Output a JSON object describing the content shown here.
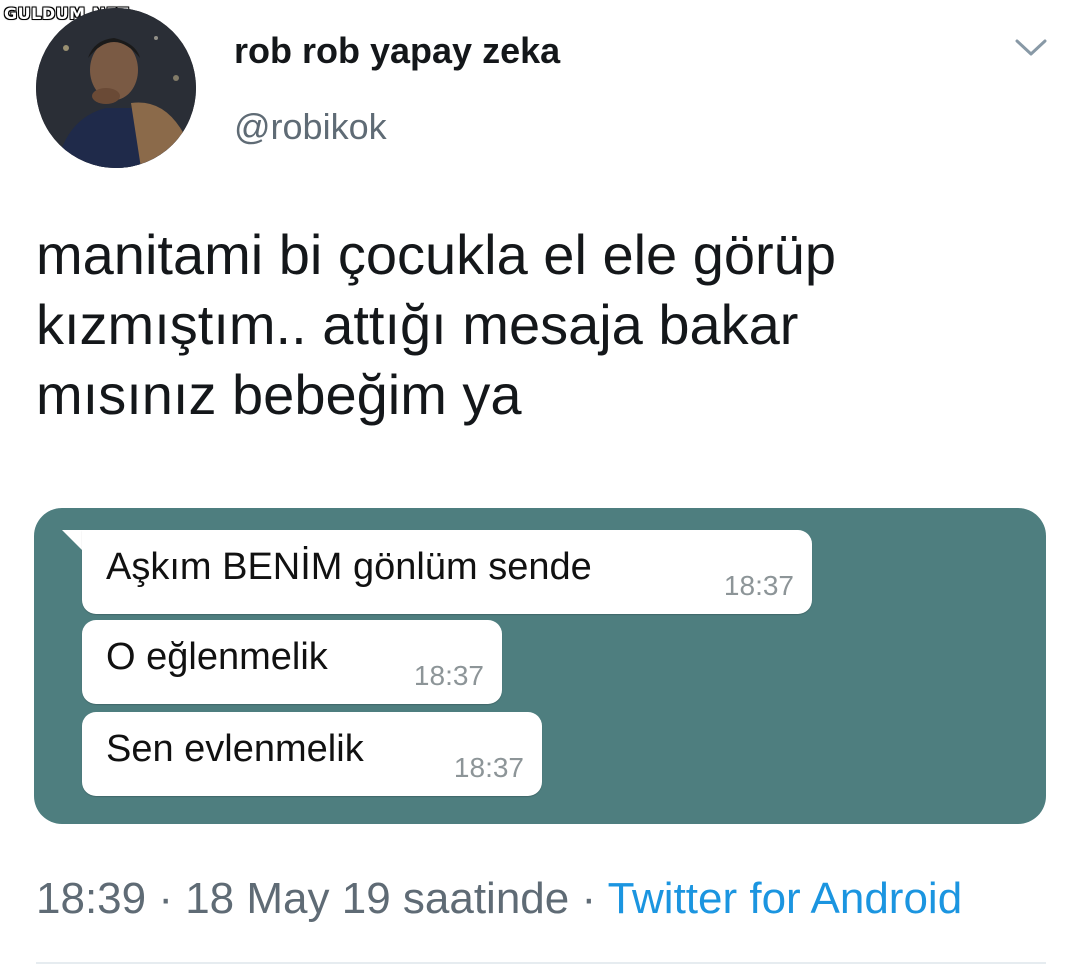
{
  "watermark": "GULDUM.NET",
  "author": {
    "display_name": "rob rob yapay zeka",
    "handle": "@robikok",
    "avatar": "avatar-photo"
  },
  "menu_icon": "chevron-down-icon",
  "tweet": {
    "text": "manitami bi çocukla el ele görüp\nkızmıştım.. attığı mesaja bakar\nmısınız bebeğim ya"
  },
  "chat": {
    "background": "#4e7e7f",
    "messages": [
      {
        "text": "Aşkım BENİM gönlüm sende",
        "time": "18:37"
      },
      {
        "text": "O eğlenmelik",
        "time": "18:37"
      },
      {
        "text": "Sen evlenmelik",
        "time": "18:37"
      }
    ]
  },
  "meta": {
    "timestamp": "18:39 · 18 May 19 saatinde · ",
    "source": "Twitter for Android",
    "source_color": "#1b95e0"
  }
}
